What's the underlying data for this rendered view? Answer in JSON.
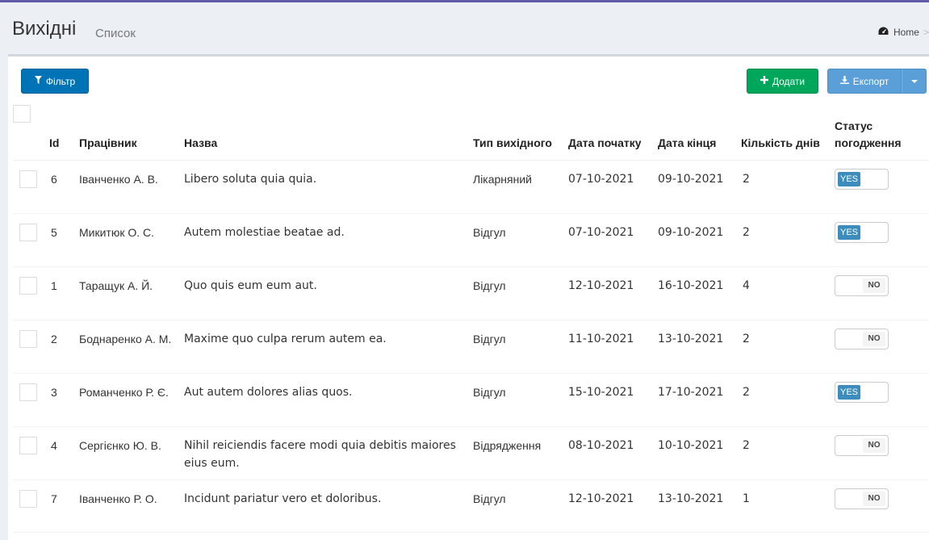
{
  "header": {
    "title": "Вихідні",
    "subtitle": "Список",
    "breadcrumb_home": "Home",
    "breadcrumb_icon": "dashboard-icon"
  },
  "toolbar": {
    "filter_label": "Фільтр",
    "add_label": "Додати",
    "export_label": "Експорт"
  },
  "table": {
    "columns": {
      "id": "Id",
      "employee": "Працівник",
      "title": "Назва",
      "type": "Тип вихідного",
      "start": "Дата початку",
      "end": "Дата кінця",
      "days": "Кількість днів",
      "status": "Статус погодження"
    },
    "rows": [
      {
        "id": "6",
        "employee": "Іванченко А. В.",
        "title": "Libero soluta quia quia.",
        "type": "Лікарняний",
        "start": "07-10-2021",
        "end": "09-10-2021",
        "days": "2",
        "status": "YES"
      },
      {
        "id": "5",
        "employee": "Микитюк О. С.",
        "title": "Autem molestiae beatae ad.",
        "type": "Відгул",
        "start": "07-10-2021",
        "end": "09-10-2021",
        "days": "2",
        "status": "YES"
      },
      {
        "id": "1",
        "employee": "Таращук А. Й.",
        "title": "Quo quis eum eum aut.",
        "type": "Відгул",
        "start": "12-10-2021",
        "end": "16-10-2021",
        "days": "4",
        "status": "NO"
      },
      {
        "id": "2",
        "employee": "Боднаренко А. М.",
        "title": "Maxime quo culpa rerum autem ea.",
        "type": "Відгул",
        "start": "11-10-2021",
        "end": "13-10-2021",
        "days": "2",
        "status": "NO"
      },
      {
        "id": "3",
        "employee": "Романченко Р. Є.",
        "title": "Aut autem dolores alias quos.",
        "type": "Відгул",
        "start": "15-10-2021",
        "end": "17-10-2021",
        "days": "2",
        "status": "YES"
      },
      {
        "id": "4",
        "employee": "Сергієнко Ю. В.",
        "title": "Nihil reiciendis facere modi quia debitis maiores eius eum.",
        "type": "Відрядження",
        "start": "08-10-2021",
        "end": "10-10-2021",
        "days": "2",
        "status": "NO"
      },
      {
        "id": "7",
        "employee": "Іванченко Р. О.",
        "title": "Incidunt pariatur vero et doloribus.",
        "type": "Відгул",
        "start": "12-10-2021",
        "end": "13-10-2021",
        "days": "1",
        "status": "NO"
      }
    ]
  },
  "colors": {
    "filter_button": "#0073b7",
    "add_button": "#00a65a",
    "export_button": "#5b9fd8",
    "switch_on": "#3c8dbc",
    "top_stripe": "#605ca8"
  }
}
